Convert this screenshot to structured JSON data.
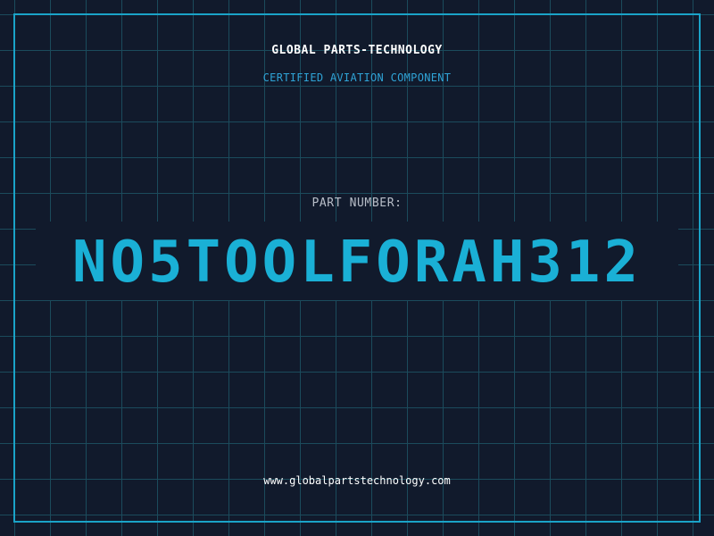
{
  "company_name": "GLOBAL PARTS-TECHNOLOGY",
  "tagline": "CERTIFIED AVIATION COMPONENT",
  "part_number_label": "PART NUMBER:",
  "part_number": "NO5TOOLFORAH312",
  "website": "www.globalpartstechnology.com",
  "colors": {
    "background": "#111a2c",
    "grid": "#1b4b5c",
    "accent": "#1ab0d6",
    "text": "#ffffff"
  }
}
